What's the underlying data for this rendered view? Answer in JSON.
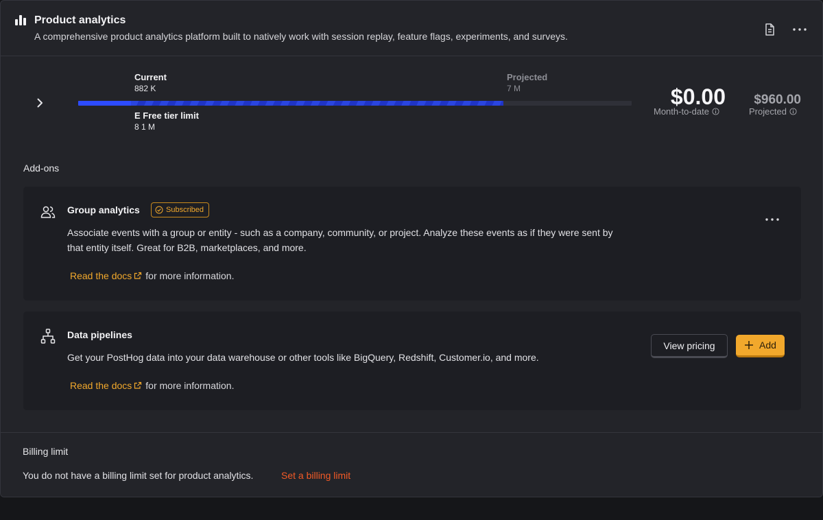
{
  "header": {
    "title": "Product analytics",
    "description": "A comprehensive product analytics platform built to natively work with session replay, feature flags, experiments, and surveys.",
    "icon": "bar-chart-icon",
    "actions": [
      "document-icon",
      "more-icon"
    ]
  },
  "usage": {
    "current_label": "Current",
    "current_value": "882 K",
    "projected_label": "Projected",
    "projected_value": "7 M",
    "free_tier_prefix": "E",
    "free_tier_label": "Free tier limit",
    "free_tier_value_prefix": "8",
    "free_tier_value": "1 M",
    "current_fraction": 0.095,
    "projected_fraction": 0.768,
    "colors": {
      "current": "#2d4bff",
      "projected": "#1f34c6",
      "track": "#2f3038"
    }
  },
  "amounts": {
    "month_to_date": "$0.00",
    "month_to_date_label": "Month-to-date",
    "projected": "$960.00",
    "projected_label": "Projected"
  },
  "addons_title": "Add-ons",
  "addons": [
    {
      "title": "Group analytics",
      "icon": "people-icon",
      "badge": "Subscribed",
      "description": "Associate events with a group or entity - such as a company, community, or project. Analyze these events as if they were sent by that entity itself. Great for B2B, marketplaces, and more.",
      "docs_link": "Read the docs",
      "docs_suffix": "for more information."
    },
    {
      "title": "Data pipelines",
      "icon": "pipeline-icon",
      "description": "Get your PostHog data into your data warehouse or other tools like BigQuery, Redshift, Customer.io, and more.",
      "docs_link": "Read the docs",
      "docs_suffix": "for more information.",
      "view_pricing": "View pricing",
      "add": "Add"
    }
  ],
  "billing_limit": {
    "title": "Billing limit",
    "text": "You do not have a billing limit set for product analytics.",
    "link": "Set a billing limit"
  },
  "colors": {
    "accent": "#f1a82c",
    "danger_link": "#f35a26",
    "background": "#232429"
  }
}
